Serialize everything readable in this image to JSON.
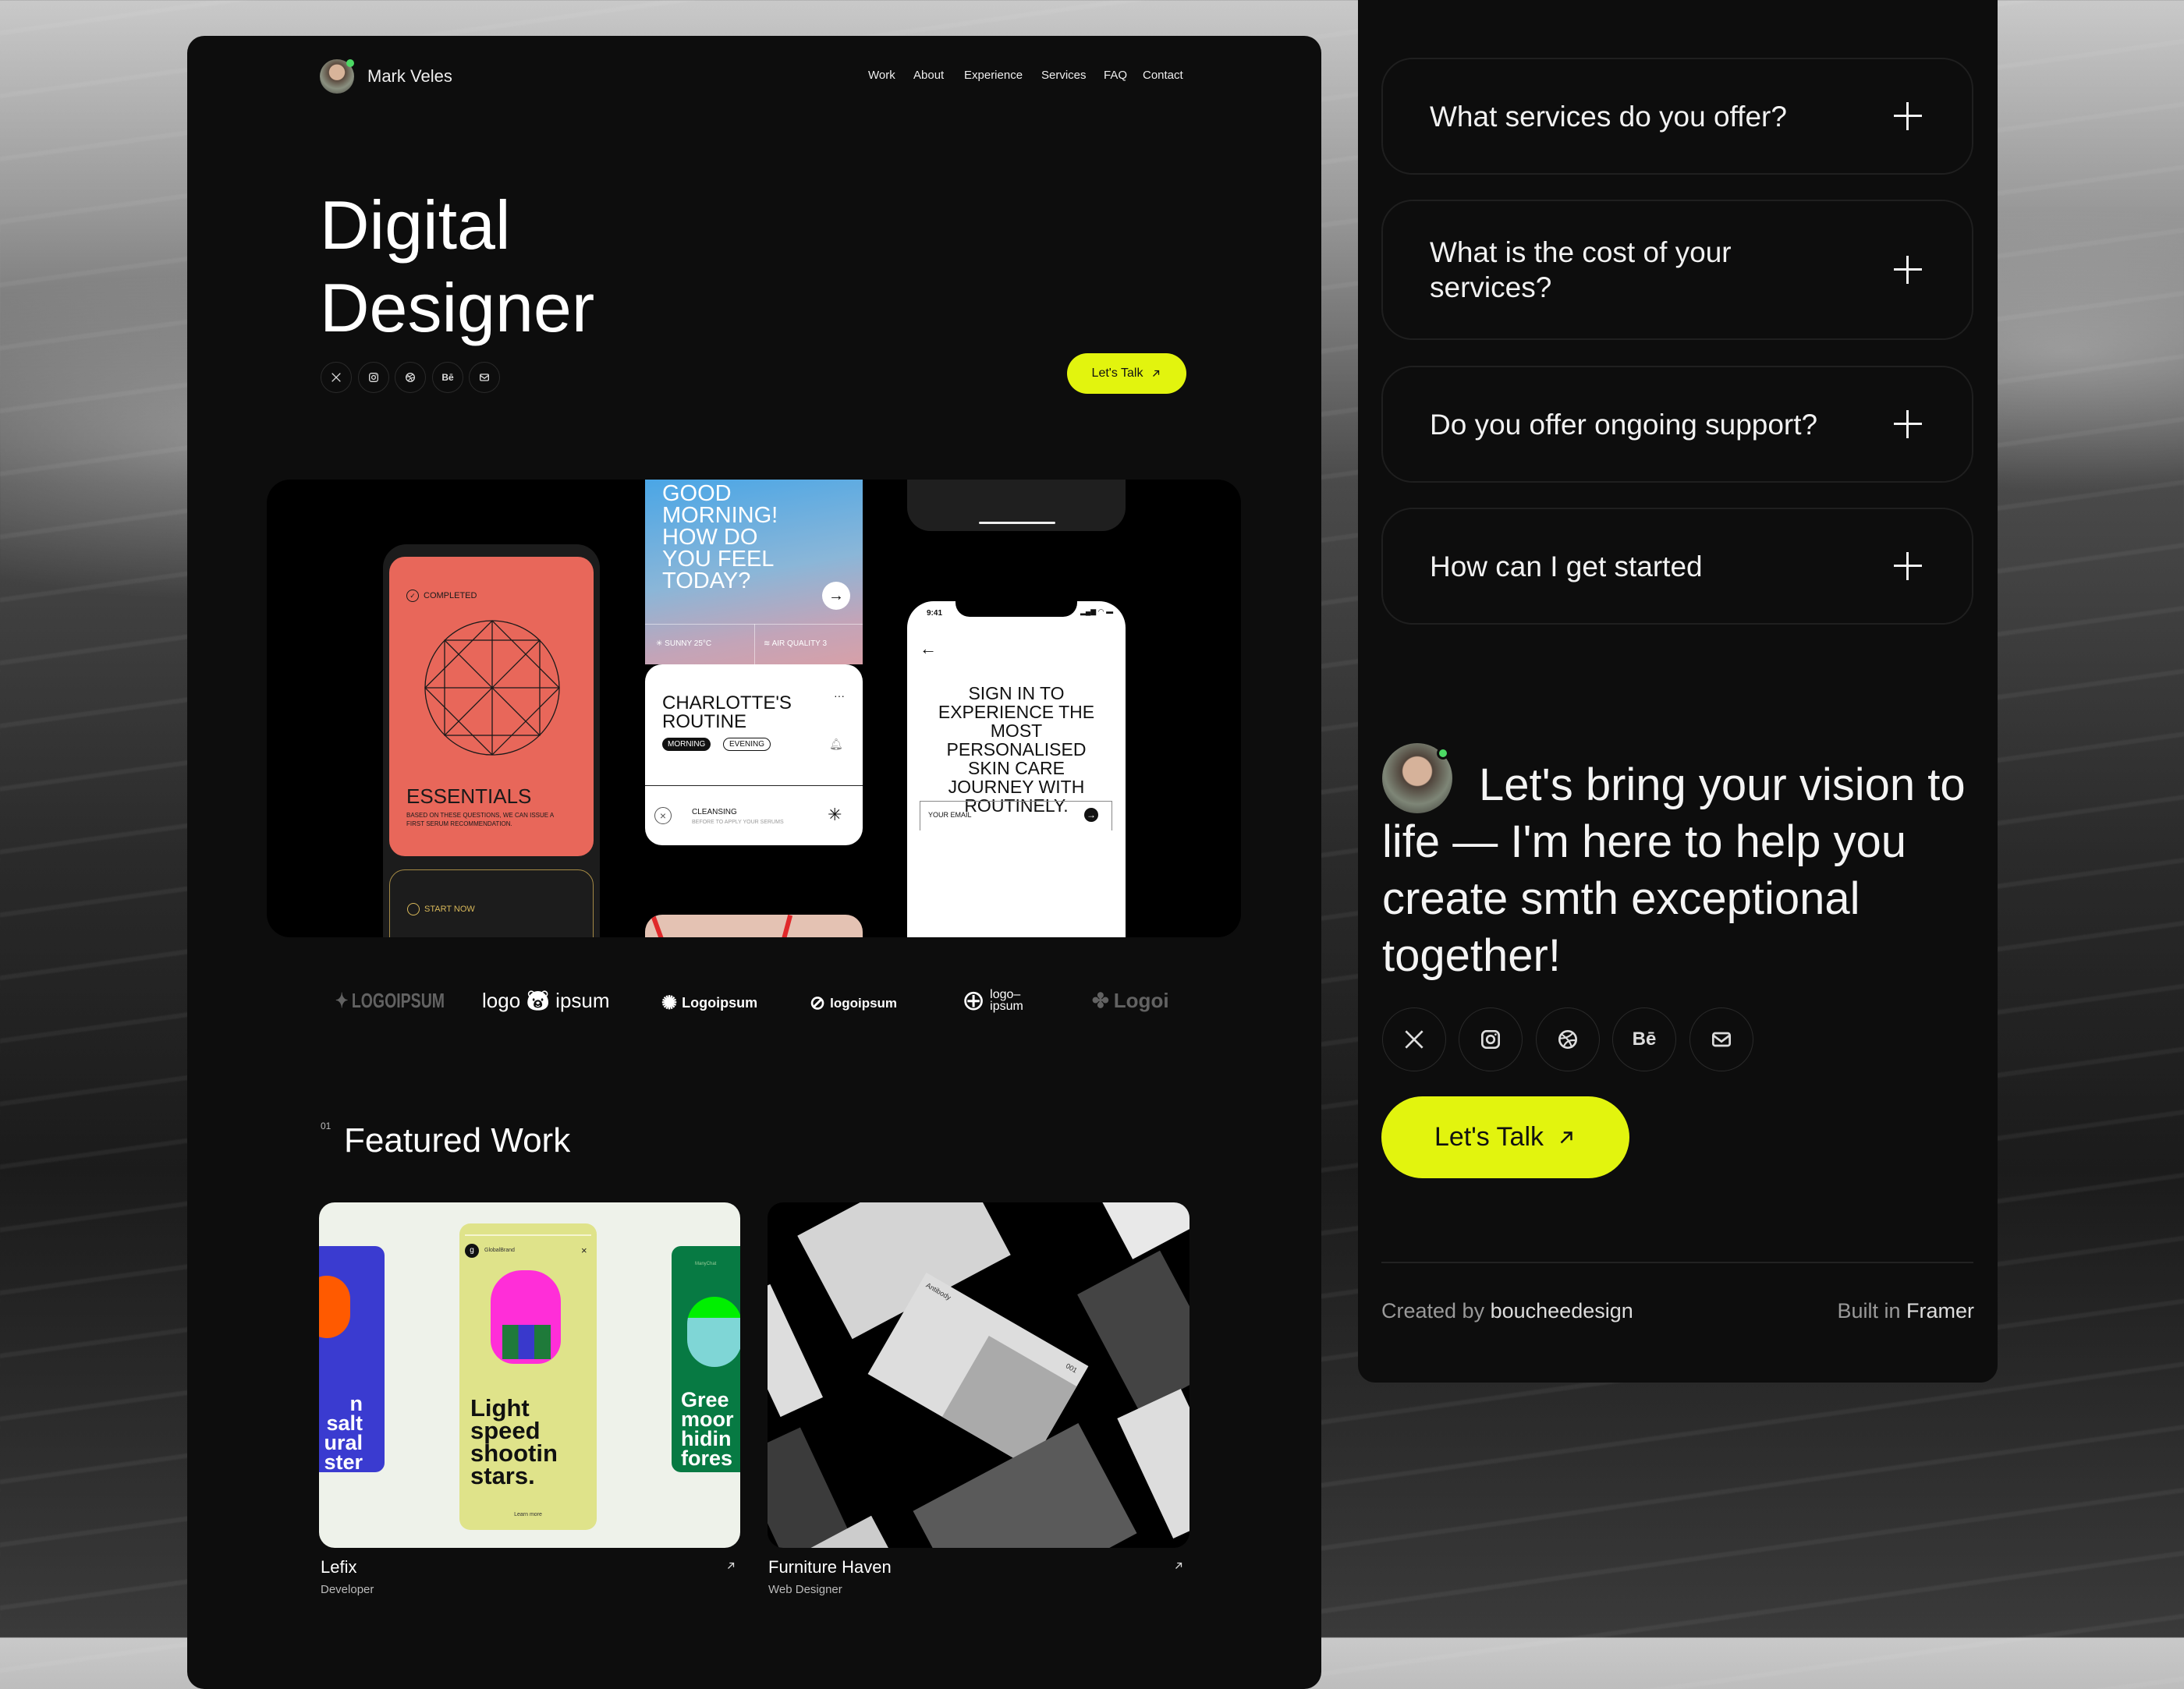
{
  "header": {
    "name": "Mark Veles",
    "nav": [
      "Work",
      "About",
      "Experience",
      "Services",
      "FAQ",
      "Contact"
    ]
  },
  "hero": {
    "title_line1": "Digital",
    "title_line2": "Designer",
    "cta": "Let's Talk",
    "socials": [
      "x-icon",
      "instagram-icon",
      "dribbble-icon",
      "behance-icon",
      "mail-icon"
    ],
    "behance_text": "Bē"
  },
  "showcase": {
    "phone1": {
      "status": "COMPLETED",
      "title": "ESSENTIALS",
      "desc": "BASED ON THESE QUESTIONS, WE CAN ISSUE A FIRST SERUM RECOMMENDATION.",
      "start": "START NOW"
    },
    "phone2": {
      "greeting": "GOOD MORNING! HOW DO YOU FEEL TODAY?",
      "weather": "SUNNY 25°C",
      "air": "AIR QUALITY 3",
      "routine": "CHARLOTTE'S ROUTINE",
      "tab_morning": "MORNING",
      "tab_evening": "EVENING",
      "step": "CLEANSING",
      "step_sub": "BEFORE TO APPLY YOUR SERUMS",
      "more": "···"
    },
    "phone3": {
      "time": "9:41",
      "headline": "SIGN IN TO EXPERIENCE THE MOST PERSONALISED SKIN CARE JOURNEY WITH ROUTINELY.",
      "email_placeholder": "YOUR EMAIL"
    }
  },
  "logos": [
    "LOGOIPSUM",
    "logo",
    "ipsum",
    "Logoipsum",
    "logoipsum",
    "logo–",
    "ipsum",
    "Logoi"
  ],
  "featured": {
    "index": "01",
    "title": "Featured Work",
    "items": [
      {
        "title": "Lefix",
        "role": "Developer",
        "story_main": "Light speed shootin stars.",
        "story_left": "n salt ural ster ter.",
        "story_right": "Gree moor hidin fores",
        "brand": "GlobalBrand",
        "brand2": "ManyChat",
        "learn": "Learn more"
      },
      {
        "title": "Furniture Haven",
        "role": "Web Designer",
        "tag": "Antibody",
        "num": "001"
      }
    ]
  },
  "faq": [
    "What services do you offer?",
    "What is the cost of your services?",
    "Do you offer ongoing support?",
    "How can I get started"
  ],
  "contact": {
    "headline": "Let's bring your vision to life — I'm here to help you create smth exceptional together!",
    "cta": "Let's Talk"
  },
  "footer": {
    "created_prefix": "Created by",
    "created_name": "boucheedesign",
    "built_prefix": "Built in",
    "built_name": "Framer"
  },
  "colors": {
    "accent": "#e2f40e",
    "panel": "#0d0d0d",
    "coral": "#e8675a",
    "status_dot": "#4cd964"
  }
}
